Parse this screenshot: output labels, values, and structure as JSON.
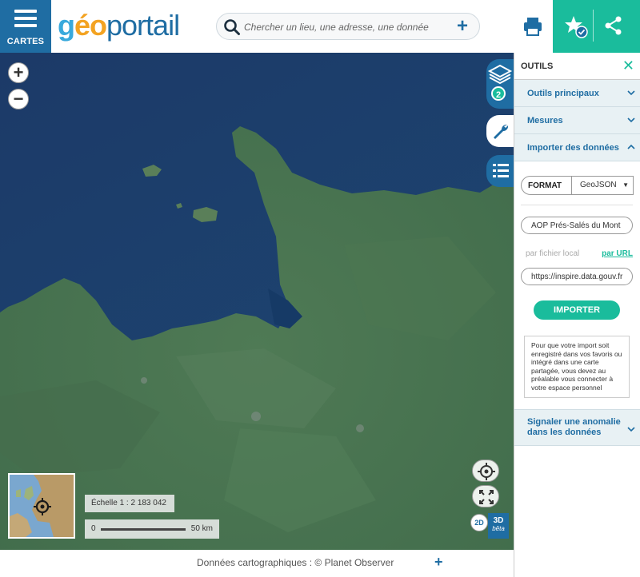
{
  "header": {
    "menu_label": "CARTES",
    "logo_geo": "g",
    "logo_o": "éo",
    "logo_portail": "portail",
    "search_placeholder": "Chercher un lieu, une adresse, une donnée"
  },
  "map_controls": {
    "zoom_in": "+",
    "zoom_out": "−",
    "layers_count": "2",
    "dim_2d": "2D",
    "dim_3d": "3D",
    "dim_3d_badge": "bêta"
  },
  "scale": {
    "label": "Échelle 1 : 2 183 042",
    "start": "0",
    "end": "50 km"
  },
  "footer": {
    "credits": "Données cartographiques : ©  Planet Observer",
    "expand": "+"
  },
  "panel": {
    "title": "OUTILS",
    "close": "✕",
    "sections": [
      {
        "label": "Outils principaux"
      },
      {
        "label": "Mesures"
      },
      {
        "label": "Importer des données"
      }
    ],
    "format_label": "FORMAT",
    "format_value": "GeoJSON",
    "name_value": "AOP Prés-Salés du Mont",
    "source_local": "par fichier local",
    "source_url": "par URL",
    "url_value": "https://inspire.data.gouv.fr",
    "import_button": "IMPORTER",
    "notice": "Pour que votre import soit enregistré dans vos favoris ou intégré dans une carte partagée, vous devez au préalable vous connecter à votre espace personnel",
    "report_label": "Signaler une anomalie dans les données"
  },
  "colors": {
    "brand_blue": "#1f6da3",
    "accent_green": "#1abc9c"
  }
}
